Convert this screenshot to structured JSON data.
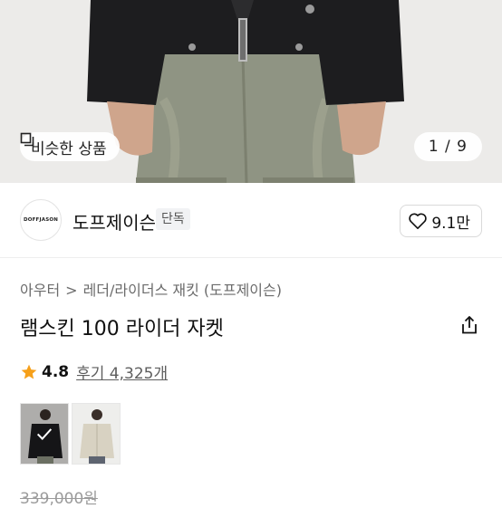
{
  "hero": {
    "similar_label": "비슷한 상품",
    "counter": "1 / 9"
  },
  "brand": {
    "logo_text": "DOFFJASON",
    "name": "도프제이슨",
    "badge": "단독",
    "like_count": "9.1만"
  },
  "product": {
    "breadcrumb": [
      "아우터",
      "레더/라이더스 재킷 (도프제이슨)"
    ],
    "breadcrumb_sep": ">",
    "title": "램스킨 100 라이더 자켓",
    "rating": "4.8",
    "reviews": "후기 4,325개",
    "original_price": "339,000원"
  },
  "swatches": [
    {
      "color": "black",
      "selected": true
    },
    {
      "color": "beige",
      "selected": false
    }
  ],
  "colors": {
    "star": "#f6a01a",
    "jacket_black": "#1d1d1f",
    "jeans": "#8f9483"
  }
}
